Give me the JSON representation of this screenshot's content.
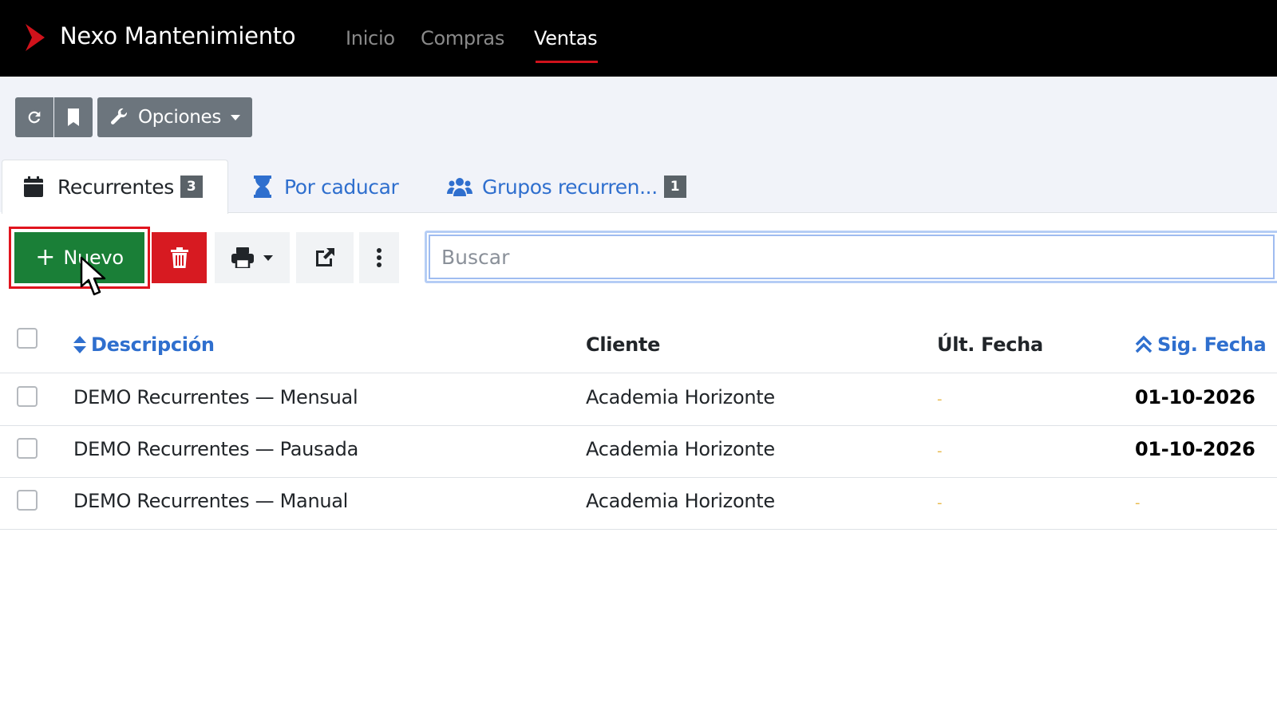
{
  "app": {
    "name": "Nexo Mantenimiento",
    "logo_icon": "chevron-right-icon",
    "brand_color": "#d0121b"
  },
  "nav": {
    "items": [
      {
        "label": "Inicio",
        "active": false
      },
      {
        "label": "Compras",
        "active": false
      },
      {
        "label": "Ventas",
        "active": true
      }
    ]
  },
  "toolbar": {
    "refresh_icon": "refresh-icon",
    "bookmark_icon": "bookmark-icon",
    "options_label": "Opciones",
    "options_icon": "wrench-icon"
  },
  "tabs": [
    {
      "label": "Recurrentes",
      "icon": "calendar-icon",
      "badge": "3",
      "active": true
    },
    {
      "label": "Por caducar",
      "icon": "hourglass-icon",
      "badge": "",
      "active": false
    },
    {
      "label": "Grupos recurren...",
      "icon": "users-icon",
      "badge": "1",
      "active": false
    }
  ],
  "actions": {
    "new_label": "Nuevo",
    "new_icon": "plus-icon",
    "delete_icon": "trash-icon",
    "print_icon": "print-icon",
    "export_icon": "external-link-icon",
    "more_icon": "more-vertical-icon",
    "new_color": "#1a7f37",
    "delete_color": "#d71a21"
  },
  "search": {
    "placeholder": "Buscar",
    "value": ""
  },
  "table": {
    "columns": [
      {
        "label": "Descripción",
        "sortable": true,
        "sort_icon": "sort-icon"
      },
      {
        "label": "Cliente",
        "sortable": false
      },
      {
        "label": "Últ. Fecha",
        "sortable": false
      },
      {
        "label": "Sig. Fecha",
        "sortable": true,
        "sort_icon": "sort-up-icon"
      }
    ],
    "rows": [
      {
        "descripcion": "DEMO Recurrentes — Mensual",
        "cliente": "Academia Horizonte",
        "ult_fecha": "-",
        "sig_fecha": "01-10-2026"
      },
      {
        "descripcion": "DEMO Recurrentes — Pausada",
        "cliente": "Academia Horizonte",
        "ult_fecha": "-",
        "sig_fecha": "01-10-2026"
      },
      {
        "descripcion": "DEMO Recurrentes — Manual",
        "cliente": "Academia Horizonte",
        "ult_fecha": "-",
        "sig_fecha": "-"
      }
    ]
  }
}
